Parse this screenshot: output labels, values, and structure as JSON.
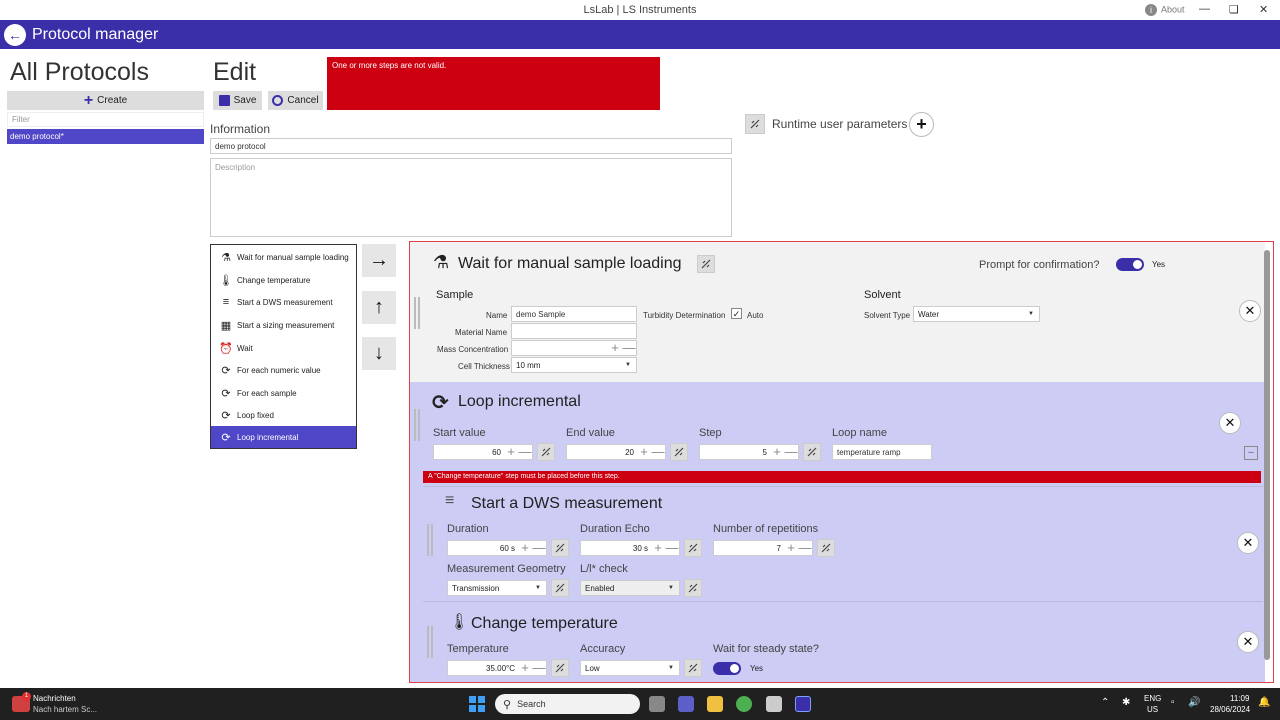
{
  "window": {
    "title": "LsLab | LS Instruments",
    "about": "About"
  },
  "header": {
    "title": "Protocol manager"
  },
  "left": {
    "heading": "All Protocols",
    "create": "Create",
    "filter_placeholder": "Filter",
    "items": [
      "demo protocol*"
    ]
  },
  "edit": {
    "heading": "Edit",
    "save": "Save",
    "cancel": "Cancel",
    "error": "One or more steps are not valid.",
    "info_label": "Information",
    "name_value": "demo protocol",
    "description_placeholder": "Description",
    "runtime": "Runtime user parameters"
  },
  "step_types": [
    "Wait for manual sample loading",
    "Change temperature",
    "Start a DWS measurement",
    "Start a sizing measurement",
    "Wait",
    "For each numeric value",
    "For each sample",
    "Loop fixed",
    "Loop incremental"
  ],
  "step_icons": [
    "flask-icon",
    "thermometer-icon",
    "dws-icon",
    "sizing-icon",
    "alarm-icon",
    "loop-icon",
    "loop-icon",
    "loop-icon",
    "loop-icon"
  ],
  "card1": {
    "title": "Wait for manual sample loading",
    "prompt": "Prompt for confirmation?",
    "prompt_value": "Yes",
    "sample": "Sample",
    "name_label": "Name",
    "name": "demo Sample",
    "material_label": "Material Name",
    "material": "",
    "mass_label": "Mass Concentration",
    "cell_label": "Cell Thickness",
    "cell": "10 mm",
    "turbidity": "Turbidity Determination",
    "auto": "Auto",
    "solvent": "Solvent",
    "solvent_type_label": "Solvent Type",
    "solvent_type": "Water"
  },
  "card2": {
    "title": "Loop incremental",
    "start_label": "Start value",
    "start": "60",
    "end_label": "End value",
    "end": "20",
    "step_label": "Step",
    "step": "5",
    "loopname_label": "Loop name",
    "loopname": "temperature ramp",
    "warning": "A \"Change temperature\" step must be placed before this step."
  },
  "card3": {
    "title": "Start a DWS measurement",
    "duration_label": "Duration",
    "duration": "60 s",
    "echo_label": "Duration Echo",
    "echo": "30 s",
    "reps_label": "Number of repetitions",
    "reps": "7",
    "geom_label": "Measurement Geometry",
    "geom": "Transmission",
    "lcheck_label": "L/l* check",
    "lcheck": "Enabled"
  },
  "card4": {
    "title": "Change temperature",
    "temp_label": "Temperature",
    "temp": "35.00°C",
    "acc_label": "Accuracy",
    "acc": "Low",
    "steady_label": "Wait for steady state?",
    "steady": "Yes"
  },
  "taskbar": {
    "notif_title": "Nachrichten",
    "notif_sub": "Nach hartem Sc...",
    "badge": "1",
    "search": "Search",
    "lang1": "ENG",
    "lang2": "US",
    "time": "11:09",
    "date": "28/06/2024"
  },
  "colors": {
    "accent": "#3a2fa8",
    "error": "#cc0010",
    "card_bg": "#ccccf5"
  }
}
